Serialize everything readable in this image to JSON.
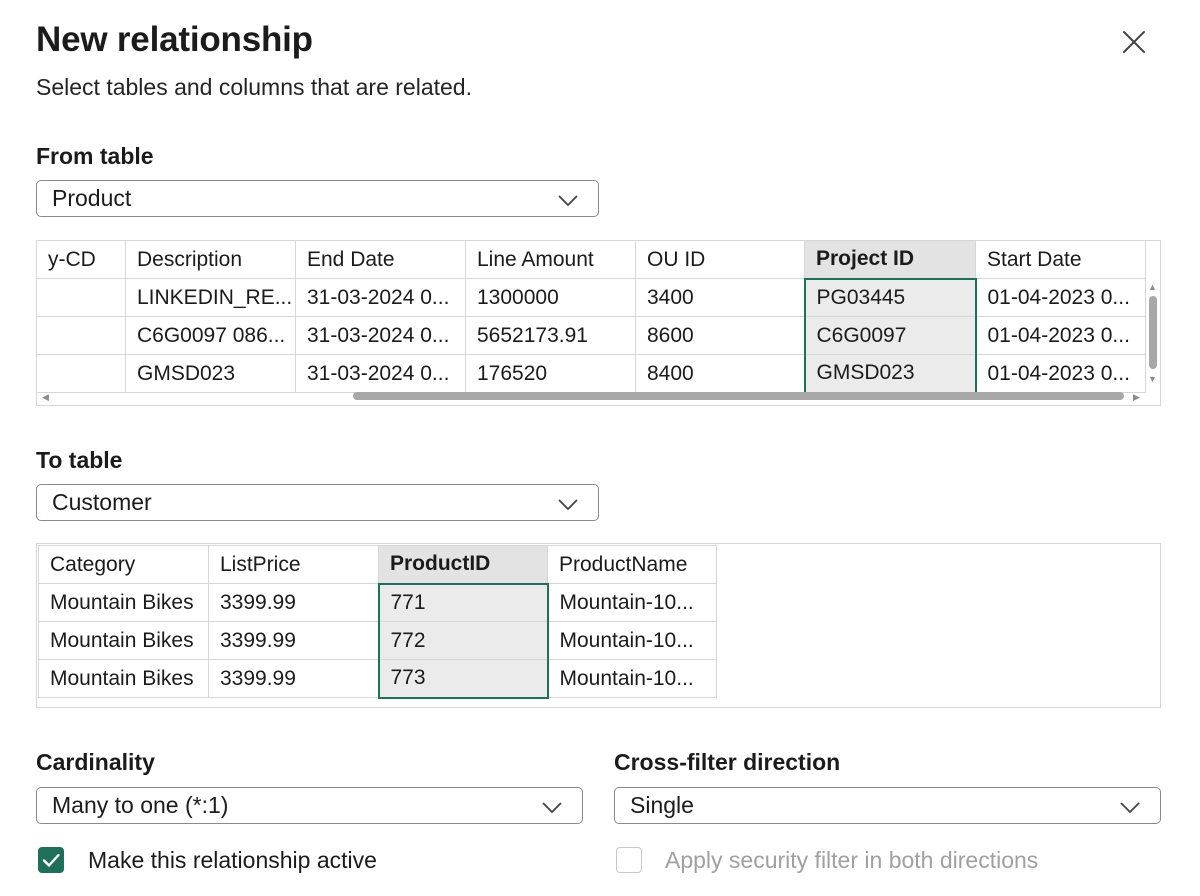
{
  "dialog": {
    "title": "New relationship",
    "subtitle": "Select tables and columns that are related."
  },
  "from": {
    "label": "From table",
    "selected": "Product",
    "columns": [
      "y-CD",
      "Description",
      "End Date",
      "Line Amount",
      "OU ID",
      "Project ID",
      "Start Date"
    ],
    "selected_column": "Project ID",
    "rows": [
      [
        "",
        "LINKEDIN_RE...",
        "31-03-2024 0...",
        "1300000",
        "3400",
        "PG03445",
        "01-04-2023 0..."
      ],
      [
        "",
        "C6G0097 086...",
        "31-03-2024 0...",
        "5652173.91",
        "8600",
        "C6G0097",
        "01-04-2023 0..."
      ],
      [
        "",
        "GMSD023",
        "31-03-2024 0...",
        "176520",
        "8400",
        "GMSD023",
        "01-04-2023 0..."
      ]
    ]
  },
  "to": {
    "label": "To table",
    "selected": "Customer",
    "columns": [
      "Category",
      "ListPrice",
      "ProductID",
      "ProductName"
    ],
    "selected_column": "ProductID",
    "rows": [
      [
        "Mountain Bikes",
        "3399.99",
        "771",
        "Mountain-10..."
      ],
      [
        "Mountain Bikes",
        "3399.99",
        "772",
        "Mountain-10..."
      ],
      [
        "Mountain Bikes",
        "3399.99",
        "773",
        "Mountain-10..."
      ]
    ]
  },
  "cardinality": {
    "label": "Cardinality",
    "selected": "Many to one (*:1)"
  },
  "cross_filter": {
    "label": "Cross-filter direction",
    "selected": "Single"
  },
  "active_checkbox": {
    "label": "Make this relationship active",
    "checked": true
  },
  "security_checkbox": {
    "label": "Apply security filter in both directions",
    "checked": false,
    "disabled": true
  },
  "colors": {
    "accent": "#1f6f5a",
    "selected_header": "#e3e3e3",
    "border": "#d6d6d6",
    "disabled_text": "#a0a0a0"
  },
  "icons": {
    "close": "close-icon",
    "dropdown": "chevron-down-icon",
    "check": "checkmark-icon"
  }
}
